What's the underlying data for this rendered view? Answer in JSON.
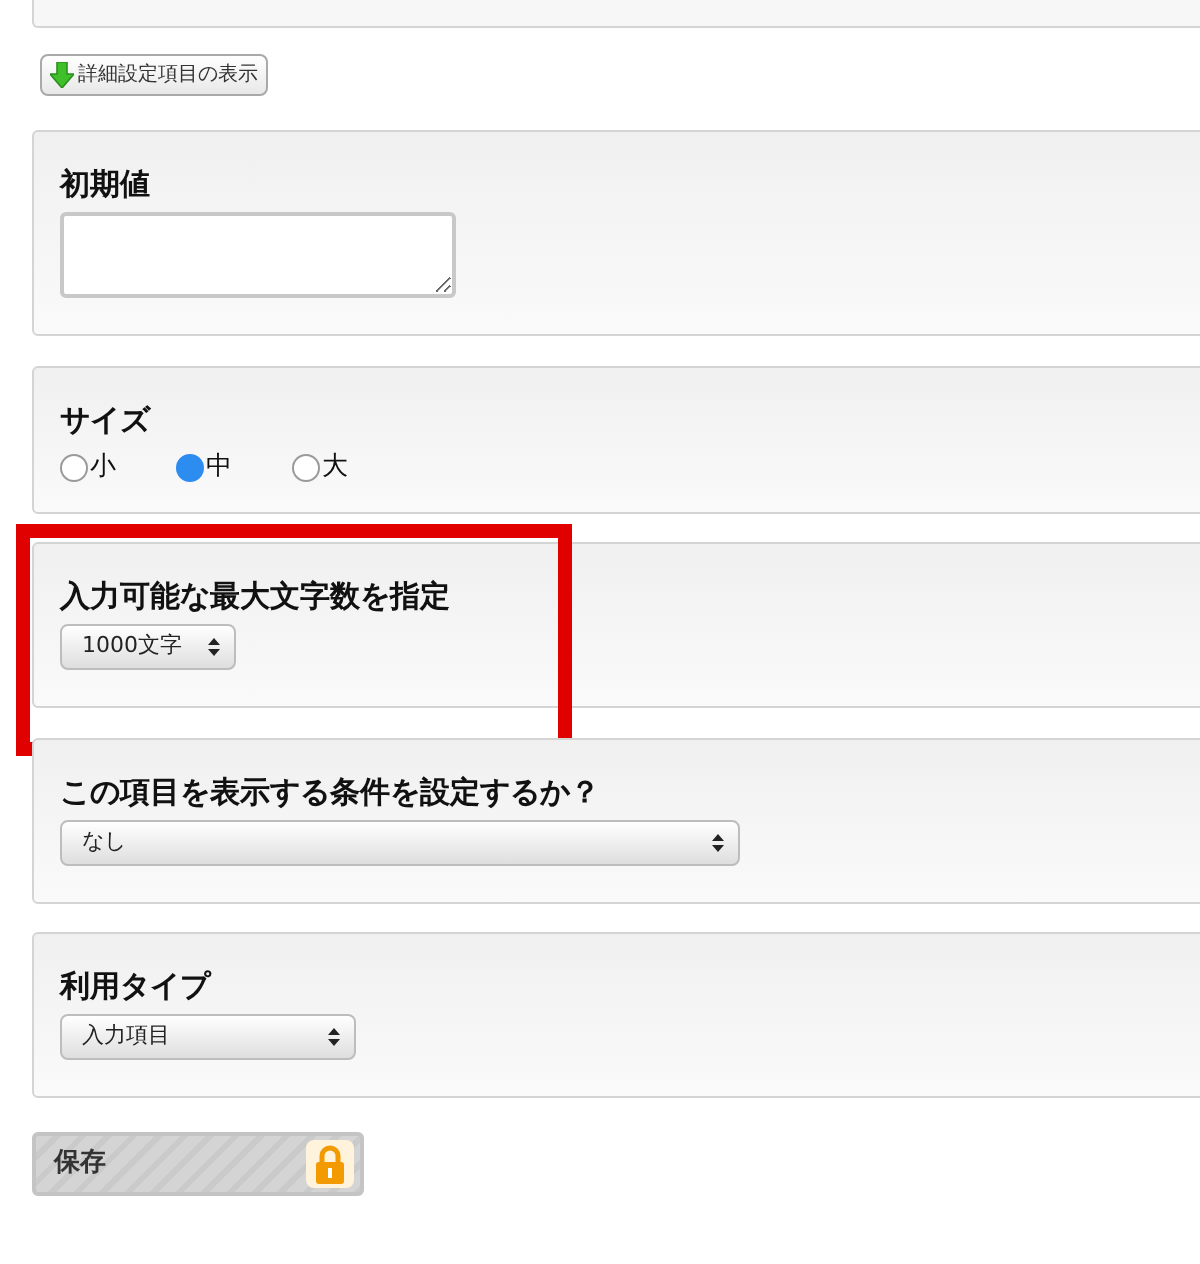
{
  "advanced_button": {
    "label": "詳細設定項目の表示"
  },
  "sections": [
    {
      "kind": "textarea",
      "label": "初期値",
      "highlighted": false
    },
    {
      "kind": "radio",
      "label": "サイズ",
      "highlighted": false,
      "options": [
        {
          "label": "小",
          "selected": false
        },
        {
          "label": "中",
          "selected": true
        },
        {
          "label": "大",
          "selected": false
        }
      ]
    },
    {
      "kind": "select",
      "label": "入力可能な最大文字数を指定",
      "value": "1000文字",
      "highlighted": true
    },
    {
      "kind": "select",
      "label": "この項目を表示する条件を設定するか？",
      "value": "なし",
      "highlighted": false
    },
    {
      "kind": "select",
      "label": "利用タイプ",
      "value": "入力項目",
      "highlighted": false
    }
  ],
  "save_button": {
    "label": "保存",
    "locked": true
  }
}
